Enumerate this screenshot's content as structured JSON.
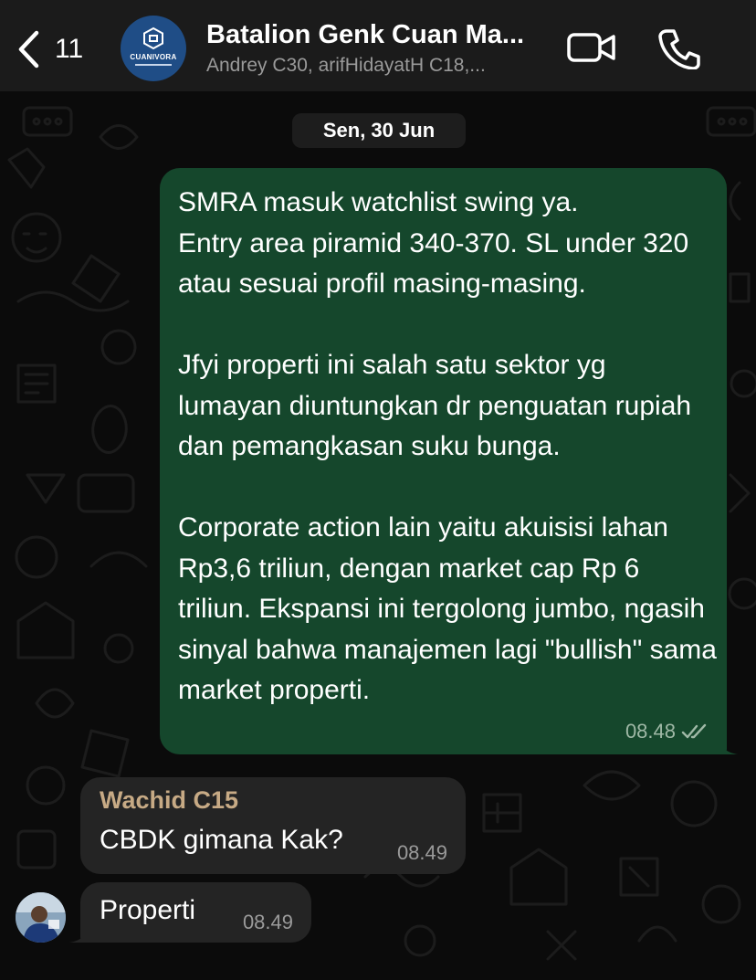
{
  "header": {
    "back_count": "11",
    "avatar_logo_text": "CUANIVORA",
    "title": "Batalion Genk Cuan Ma...",
    "subtitle": "Andrey C30, arifHidayatH C18,..."
  },
  "icons": {
    "back": "chevron-left-icon",
    "video": "video-camera-icon",
    "call": "phone-icon",
    "read_status": "double-check-icon"
  },
  "colors": {
    "outgoing_bubble": "#15472c",
    "incoming_bubble": "#242424",
    "sender_name": "#c7aa85",
    "header_bg": "#1b1b1b",
    "background": "#0b0b0b"
  },
  "date_separator": "Sen, 30 Jun",
  "messages": [
    {
      "direction": "outgoing",
      "text": "SMRA masuk watchlist swing ya.\nEntry area piramid 340-370. SL under 320 atau sesuai profil masing-masing.\n\nJfyi properti ini salah satu sektor yg lumayan diuntungkan dr penguatan rupiah dan pemangkasan suku bunga.\n\nCorporate action lain yaitu akuisisi lahan Rp3,6 triliun, dengan market cap Rp 6 triliun. Ekspansi ini tergolong jumbo, ngasih sinyal bahwa manajemen lagi \"bullish\" sama market properti.",
      "time": "08.48",
      "status": "read"
    },
    {
      "direction": "incoming",
      "sender": "Wachid C15",
      "text": "CBDK gimana Kak?",
      "time": "08.49"
    },
    {
      "direction": "incoming",
      "text": "Properti",
      "time": "08.49"
    }
  ]
}
